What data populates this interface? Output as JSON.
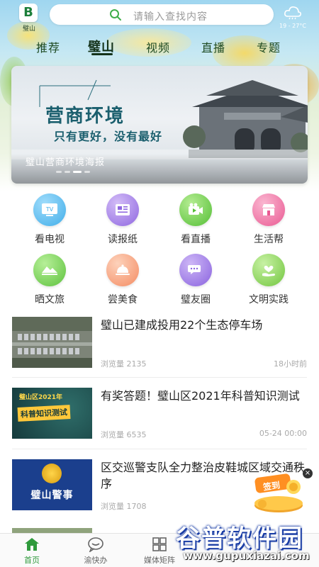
{
  "header": {
    "logo_text": "璧山",
    "search_placeholder": "请输入查找内容",
    "weather": "19 - 27°C"
  },
  "tabs": [
    {
      "label": "推荐",
      "active": false
    },
    {
      "label": "璧山",
      "active": true
    },
    {
      "label": "视频",
      "active": false
    },
    {
      "label": "直播",
      "active": false
    },
    {
      "label": "专题",
      "active": false
    }
  ],
  "banner": {
    "headline": "营商环境",
    "subline": "只有更好，没有最好",
    "caption": "璧山营商环境海报",
    "active_slide": 3,
    "slide_count": 4
  },
  "grid": [
    {
      "label": "看电视",
      "icon": "tv-icon",
      "color": "#5bbcf0"
    },
    {
      "label": "读报纸",
      "icon": "newspaper-icon",
      "color": "#a17ce6"
    },
    {
      "label": "看直播",
      "icon": "live-video-icon",
      "color": "#6fcf4f"
    },
    {
      "label": "生活帮",
      "icon": "shop-icon",
      "color": "#f06aa0"
    },
    {
      "label": "晒文旅",
      "icon": "landscape-icon",
      "color": "#72d052"
    },
    {
      "label": "尝美食",
      "icon": "food-cloche-icon",
      "color": "#f7a07a"
    },
    {
      "label": "璧友圈",
      "icon": "chat-bubbles-icon",
      "color": "#9a74e6"
    },
    {
      "label": "文明实践",
      "icon": "hand-heart-icon",
      "color": "#86d255"
    }
  ],
  "news": [
    {
      "title": "璧山已建成投用22个生态停车场",
      "views": "浏览量 2135",
      "time": "18小时前",
      "thumb_text": ""
    },
    {
      "title": "有奖答题！璧山区2021年科普知识测试",
      "views": "浏览量 6535",
      "time": "05-24 00:00",
      "thumb_text": "科普知识测试",
      "thumb_top": "璧山区2021年"
    },
    {
      "title": "区交巡警支队全力整治皮鞋城区域交通秩序",
      "views": "浏览量 1708",
      "time": "",
      "thumb_text": "璧山警事"
    }
  ],
  "signin": {
    "label": "签到"
  },
  "bottom_nav": [
    {
      "label": "首页",
      "icon": "home-icon",
      "active": true
    },
    {
      "label": "渝快办",
      "icon": "chat-icon",
      "active": false
    },
    {
      "label": "媒体矩阵",
      "icon": "grid-icon",
      "active": false
    }
  ],
  "watermark": {
    "cn": "谷普软件园",
    "url": "www.gupuxiazai.com"
  }
}
